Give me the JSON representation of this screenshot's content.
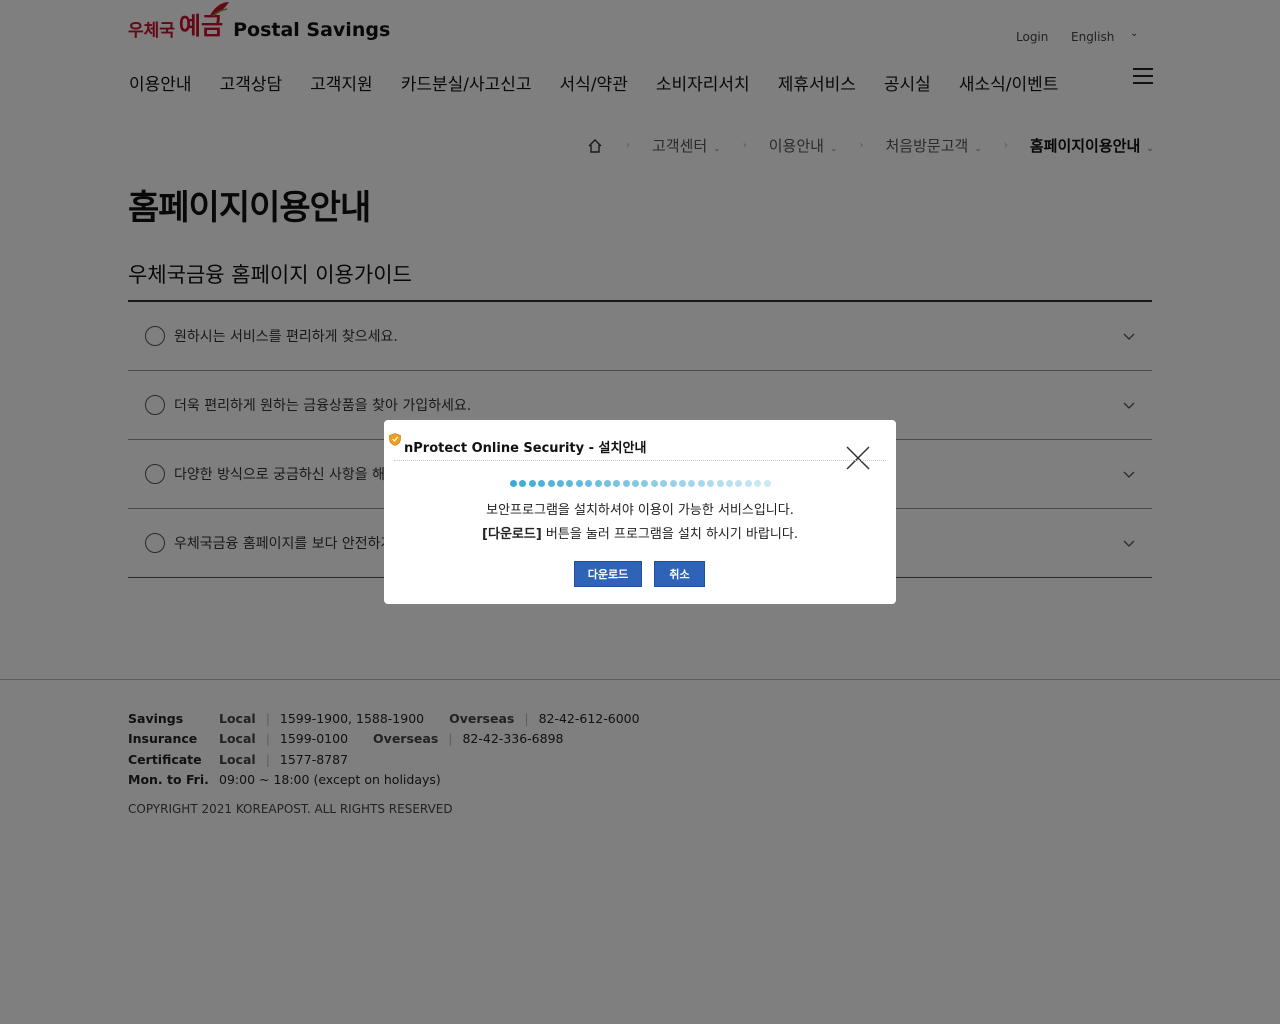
{
  "header": {
    "logo_ko_small": "우체국",
    "logo_ko_large": "예금",
    "logo_en": "Postal Savings",
    "login": "Login",
    "language": "English"
  },
  "gnb": [
    "이용안내",
    "고객상담",
    "고객지원",
    "카드분실/사고신고",
    "서식/약관",
    "소비자리서치",
    "제휴서비스",
    "공시실",
    "새소식/이벤트"
  ],
  "breadcrumb": [
    "고객센터",
    "이용안내",
    "처음방문고객",
    "홈페이지이용안내"
  ],
  "page_title": "홈페이지이용안내",
  "section_title": "우체국금융 홈페이지 이용가이드",
  "accordion": [
    "원하시는 서비스를 편리하게 찾으세요.",
    "더욱 편리하게 원하는 금융상품을 찾아 가입하세요.",
    "다양한 방식으로 궁금하신 사항을 해결",
    "우체국금융 홈페이지를 보다 안전하게"
  ],
  "footer": {
    "savings": {
      "label": "Savings",
      "local_label": "Local",
      "local": "1599-1900, 1588-1900",
      "overseas_label": "Overseas",
      "overseas": "82-42-612-6000"
    },
    "insurance": {
      "label": "Insurance",
      "local_label": "Local",
      "local": "1599-0100",
      "overseas_label": "Overseas",
      "overseas": "82-42-336-6898"
    },
    "certificate": {
      "label": "Certificate",
      "local_label": "Local",
      "local": "1577-8787"
    },
    "hours": {
      "label": "Mon. to Fri.",
      "value": "09:00 ~ 18:00 (except on holidays)"
    },
    "copyright": "COPYRIGHT 2021 KOREAPOST. ALL RIGHTS RESERVED"
  },
  "modal": {
    "title": "nProtect Online Security - 설치안내",
    "message1": "보안프로그램을 설치하셔야 이용이 가능한 서비스입니다.",
    "message2_bold": "[다운로드]",
    "message2_rest": " 버튼을 눌러 프로그램을 설치 하시기 바랍니다.",
    "download_label": "다운로드",
    "cancel_label": "취소"
  },
  "colors": {
    "brand_red": "#c8102e",
    "button_blue": "#2e63b8",
    "dots_dark": "#3fa9d6",
    "dots_light": "#cde9f5"
  }
}
